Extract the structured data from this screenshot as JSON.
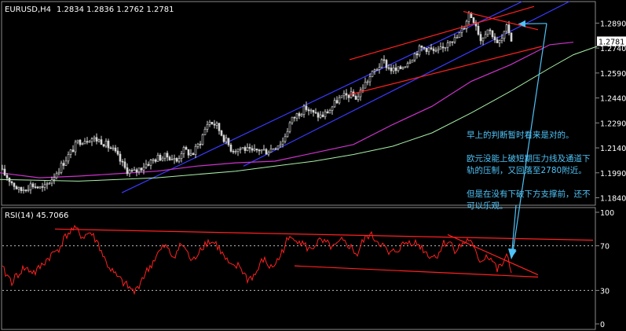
{
  "colors": {
    "background": "#000000",
    "frame": "#8a8a8a",
    "text": "#ffffff",
    "candle": "#d6d6d6",
    "ma_fast": "#cc33cc",
    "ma_slow": "#a8f0a8",
    "channel": "#3a3aff",
    "trendline": "#ff2020",
    "rsi": "#ff2020",
    "level_dots": "#bcbcbc",
    "annotation": "#4FC3F7",
    "price_marker_bg": "#ffffff",
    "price_marker_fg": "#000000"
  },
  "chart_data": [
    {
      "type": "candlestick",
      "symbol_label": "EURUSD,H4",
      "ohlc_label": "1.2834  1.2836  1.2762  1.2781",
      "current_price": "1.2781",
      "ylim": [
        1.18,
        1.301
      ],
      "y_ticks": [
        "1.2890",
        "1.2740",
        "1.2590",
        "1.2440",
        "1.2290",
        "1.2140",
        "1.1990",
        "1.1840"
      ],
      "close_path": [
        [
          0,
          1.201
        ],
        [
          10,
          1.196
        ],
        [
          25,
          1.188
        ],
        [
          40,
          1.192
        ],
        [
          55,
          1.189
        ],
        [
          70,
          1.198
        ],
        [
          85,
          1.208
        ],
        [
          100,
          1.218
        ],
        [
          115,
          1.22
        ],
        [
          130,
          1.218
        ],
        [
          145,
          1.212
        ],
        [
          160,
          1.201
        ],
        [
          170,
          1.199
        ],
        [
          185,
          1.204
        ],
        [
          200,
          1.208
        ],
        [
          215,
          1.209
        ],
        [
          225,
          1.206
        ],
        [
          232,
          1.213
        ],
        [
          245,
          1.21
        ],
        [
          255,
          1.218
        ],
        [
          265,
          1.23
        ],
        [
          275,
          1.228
        ],
        [
          285,
          1.22
        ],
        [
          295,
          1.213
        ],
        [
          310,
          1.214
        ],
        [
          320,
          1.211
        ],
        [
          330,
          1.213
        ],
        [
          340,
          1.212
        ],
        [
          350,
          1.215
        ],
        [
          360,
          1.218
        ],
        [
          370,
          1.23
        ],
        [
          380,
          1.235
        ],
        [
          390,
          1.238
        ],
        [
          400,
          1.234
        ],
        [
          410,
          1.233
        ],
        [
          420,
          1.237
        ],
        [
          430,
          1.243
        ],
        [
          445,
          1.246
        ],
        [
          455,
          1.244
        ],
        [
          462,
          1.251
        ],
        [
          470,
          1.256
        ],
        [
          478,
          1.261
        ],
        [
          488,
          1.266
        ],
        [
          495,
          1.262
        ],
        [
          505,
          1.26
        ],
        [
          515,
          1.264
        ],
        [
          525,
          1.269
        ],
        [
          535,
          1.274
        ],
        [
          545,
          1.274
        ],
        [
          555,
          1.271
        ],
        [
          565,
          1.274
        ],
        [
          572,
          1.28
        ],
        [
          580,
          1.279
        ],
        [
          590,
          1.286
        ],
        [
          597,
          1.295
        ],
        [
          605,
          1.29
        ],
        [
          612,
          1.279
        ],
        [
          620,
          1.286
        ],
        [
          628,
          1.282
        ],
        [
          633,
          1.276
        ],
        [
          640,
          1.28
        ],
        [
          646,
          1.287
        ],
        [
          652,
          1.2781
        ]
      ],
      "ma_fast": [
        [
          0,
          1.199
        ],
        [
          50,
          1.196
        ],
        [
          100,
          1.197
        ],
        [
          150,
          1.1985
        ],
        [
          200,
          1.2
        ],
        [
          250,
          1.203
        ],
        [
          300,
          1.205
        ],
        [
          350,
          1.206
        ],
        [
          400,
          1.211
        ],
        [
          450,
          1.216
        ],
        [
          500,
          1.228
        ],
        [
          550,
          1.239
        ],
        [
          600,
          1.254
        ],
        [
          650,
          1.264
        ],
        [
          700,
          1.276
        ],
        [
          730,
          1.2775
        ]
      ],
      "ma_slow": [
        [
          0,
          1.195
        ],
        [
          100,
          1.194
        ],
        [
          200,
          1.196
        ],
        [
          300,
          1.2
        ],
        [
          350,
          1.203
        ],
        [
          400,
          1.206
        ],
        [
          450,
          1.21
        ],
        [
          500,
          1.215
        ],
        [
          550,
          1.223
        ],
        [
          600,
          1.235
        ],
        [
          650,
          1.248
        ],
        [
          700,
          1.262
        ],
        [
          730,
          1.27
        ],
        [
          760,
          1.275
        ]
      ],
      "channel_lines": [
        {
          "p1": [
            155,
            1.187
          ],
          "p2": [
            665,
            1.302
          ]
        },
        {
          "p1": [
            310,
            1.203
          ],
          "p2": [
            725,
            1.302
          ]
        }
      ],
      "trend_lines": [
        {
          "p1": [
            445,
            1.267
          ],
          "p2": [
            680,
            1.299
          ]
        },
        {
          "p1": [
            445,
            1.246
          ],
          "p2": [
            690,
            1.275
          ]
        },
        {
          "p1": [
            590,
            1.296
          ],
          "p2": [
            685,
            1.285
          ]
        }
      ],
      "arrows": [
        {
          "from": [
            696,
            1.2888
          ],
          "to": [
            660,
            1.2885
          ]
        },
        {
          "from": [
            696,
            1.2888
          ],
          "to": [
            652,
            1.229
          ]
        }
      ]
    },
    {
      "type": "line",
      "label": "RSI(14) 45.7066",
      "ylim": [
        0,
        100
      ],
      "y_ticks": [
        "100",
        "70",
        "30",
        "0"
      ],
      "levels": [
        70,
        30
      ],
      "series": [
        {
          "values": [
            [
              0,
              52
            ],
            [
              15,
              38
            ],
            [
              30,
              50
            ],
            [
              45,
              46
            ],
            [
              60,
              58
            ],
            [
              75,
              68
            ],
            [
              85,
              80
            ],
            [
              95,
              86
            ],
            [
              105,
              78
            ],
            [
              115,
              82
            ],
            [
              125,
              72
            ],
            [
              135,
              55
            ],
            [
              145,
              45
            ],
            [
              155,
              38
            ],
            [
              165,
              32
            ],
            [
              172,
              28
            ],
            [
              180,
              40
            ],
            [
              190,
              50
            ],
            [
              200,
              62
            ],
            [
              210,
              70
            ],
            [
              220,
              60
            ],
            [
              232,
              72
            ],
            [
              245,
              55
            ],
            [
              255,
              68
            ],
            [
              265,
              74
            ],
            [
              275,
              72
            ],
            [
              285,
              60
            ],
            [
              295,
              50
            ],
            [
              305,
              52
            ],
            [
              315,
              40
            ],
            [
              325,
              44
            ],
            [
              335,
              58
            ],
            [
              345,
              50
            ],
            [
              355,
              58
            ],
            [
              365,
              74
            ],
            [
              375,
              78
            ],
            [
              385,
              72
            ],
            [
              395,
              66
            ],
            [
              405,
              74
            ],
            [
              415,
              72
            ],
            [
              425,
              68
            ],
            [
              435,
              74
            ],
            [
              445,
              70
            ],
            [
              455,
              62
            ],
            [
              462,
              74
            ],
            [
              470,
              80
            ],
            [
              478,
              76
            ],
            [
              488,
              70
            ],
            [
              495,
              62
            ],
            [
              505,
              66
            ],
            [
              515,
              72
            ],
            [
              525,
              74
            ],
            [
              535,
              70
            ],
            [
              545,
              62
            ],
            [
              555,
              60
            ],
            [
              565,
              72
            ],
            [
              572,
              74
            ],
            [
              580,
              66
            ],
            [
              590,
              72
            ],
            [
              597,
              76
            ],
            [
              605,
              64
            ],
            [
              612,
              56
            ],
            [
              620,
              62
            ],
            [
              628,
              56
            ],
            [
              633,
              48
            ],
            [
              640,
              54
            ],
            [
              646,
              60
            ],
            [
              652,
              45.7
            ]
          ]
        }
      ],
      "trend_lines": [
        {
          "p1": [
            70,
            85
          ],
          "p2": [
            755,
            75
          ]
        },
        {
          "p1": [
            375,
            52
          ],
          "p2": [
            685,
            42
          ]
        },
        {
          "p1": [
            570,
            80
          ],
          "p2": [
            685,
            44
          ]
        }
      ]
    }
  ],
  "annotation": {
    "line1": "早上的判断暂时看来是对的。",
    "line2": "欧元没能上破短期压力线及通道下轨的压制，又回落至2780附近。",
    "line3": "但是在没有下破下方支撑前，还不可以乐观。"
  }
}
